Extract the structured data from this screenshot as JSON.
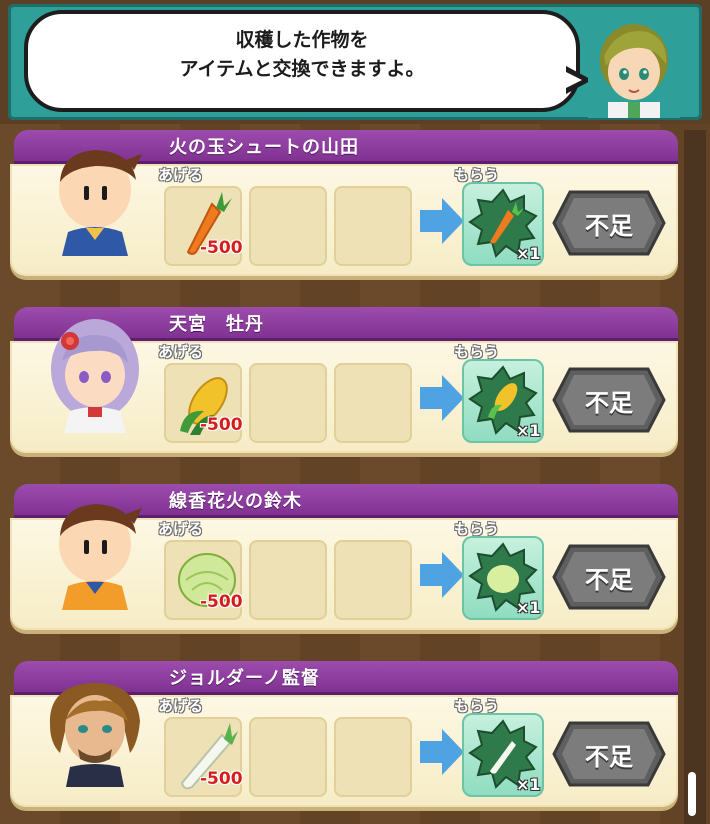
{
  "header": {
    "message_line1": "収穫した作物を",
    "message_line2": "アイテムと交換できますよ。"
  },
  "trade_labels": {
    "give": "あげる",
    "get": "もらう"
  },
  "trades": [
    {
      "name": "火の玉シュートの山田",
      "crop": "carrot-icon",
      "cost": "-500",
      "quantity": "×1",
      "button": "不足"
    },
    {
      "name": "天宮　牡丹",
      "crop": "corn-icon",
      "cost": "-500",
      "quantity": "×1",
      "button": "不足"
    },
    {
      "name": "線香花火の鈴木",
      "crop": "cabbage-icon",
      "cost": "-500",
      "quantity": "×1",
      "button": "不足"
    },
    {
      "name": "ジョルダーノ監督",
      "crop": "daikon-icon",
      "cost": "-500",
      "quantity": "×1",
      "button": "不足"
    }
  ],
  "colors": {
    "title_bar": "#8a3a9c",
    "card_body": "#fbf3d6",
    "cost_text": "#d61d1d",
    "header_frame": "#2f9f9a"
  }
}
